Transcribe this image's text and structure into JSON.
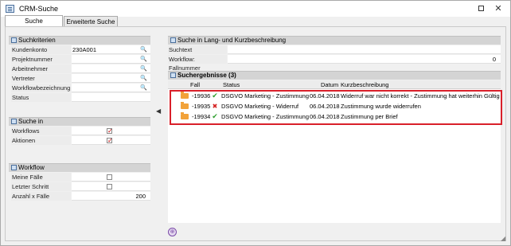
{
  "window": {
    "title": "CRM-Suche"
  },
  "tabs": [
    {
      "label": "Suche",
      "active": true
    },
    {
      "label": "Erweiterte Suche",
      "active": false
    }
  ],
  "criteria": {
    "header": "Suchkriterien",
    "fields": [
      {
        "label": "Kundenkonto",
        "value": "230A001",
        "lookup": true
      },
      {
        "label": "Projektnummer",
        "value": "",
        "lookup": true
      },
      {
        "label": "Arbeitnehmer",
        "value": "",
        "lookup": true
      },
      {
        "label": "Vertreter",
        "value": "",
        "lookup": true
      },
      {
        "label": "Workflowbezeichnung",
        "value": "",
        "lookup": true
      },
      {
        "label": "Status",
        "value": "",
        "lookup": false
      }
    ]
  },
  "search_in": {
    "header": "Suche in",
    "options": [
      {
        "label": "Workflows",
        "checked": true
      },
      {
        "label": "Aktionen",
        "checked": true
      }
    ]
  },
  "workflow": {
    "header": "Workflow",
    "meine_faelle": {
      "label": "Meine Fälle",
      "checked": false
    },
    "letzter_schritt": {
      "label": "Letzter Schritt",
      "checked": false
    },
    "anzahl": {
      "label": "Anzahl x Fälle",
      "value": "200"
    }
  },
  "text_search": {
    "header": "Suche in Lang- und Kurzbeschreibung",
    "suchtext": {
      "label": "Suchtext",
      "value": ""
    },
    "fallnummer": {
      "label": "Workflow: Fallnummer",
      "value": "0"
    }
  },
  "results": {
    "header": "Suchergebnisse (3)",
    "columns": {
      "fall": "Fall",
      "status": "Status",
      "datum": "Datum",
      "kurz": "Kurzbeschreibung"
    },
    "rows": [
      {
        "fall": "-19936",
        "status_icon": "check-icon",
        "status": "DSGVO Marketing - Zustimmung",
        "datum": "06.04.2018",
        "kurz": "Widerruf war nicht korrekt - Zustimmung hat weiterhin Gültigkeit"
      },
      {
        "fall": "-19935",
        "status_icon": "cross-icon",
        "status": "DSGVO Marketing - Widerruf",
        "datum": "06.04.2018",
        "kurz": "Zustimmung wurde widerrufen"
      },
      {
        "fall": "-19934",
        "status_icon": "check-icon",
        "status": "DSGVO Marketing - Zustimmung",
        "datum": "06.04.2018",
        "kurz": "Zustimmung per Brief"
      }
    ]
  },
  "colors": {
    "highlight": "#d9202a",
    "check": "#2e9e2e",
    "cross": "#d42020",
    "folder": "#f2a23a"
  }
}
